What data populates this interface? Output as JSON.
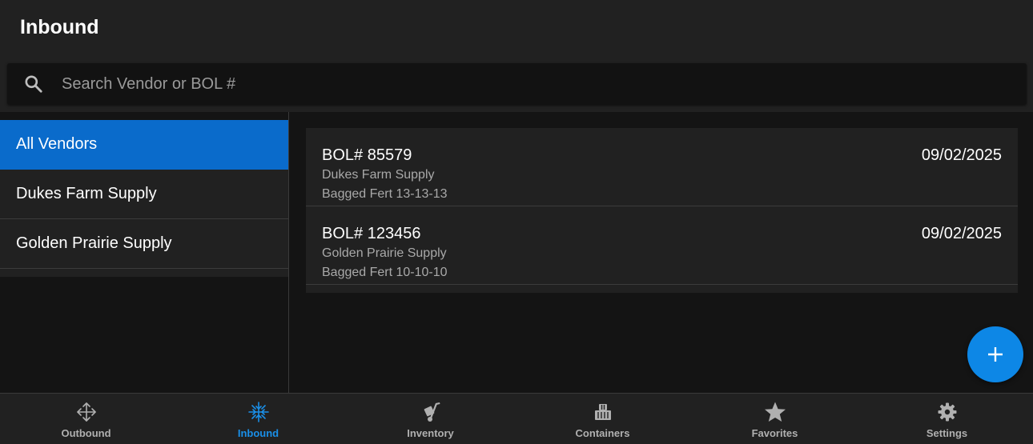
{
  "header": {
    "title": "Inbound"
  },
  "search": {
    "placeholder": "Search Vendor or BOL #",
    "value": ""
  },
  "sidebar": {
    "items": [
      {
        "label": "All Vendors",
        "active": true
      },
      {
        "label": "Dukes Farm Supply",
        "active": false
      },
      {
        "label": "Golden Prairie Supply",
        "active": false
      }
    ]
  },
  "shipments": [
    {
      "bol": "BOL# 85579",
      "date": "09/02/2025",
      "vendor": "Dukes Farm Supply",
      "product": "Bagged Fert 13-13-13"
    },
    {
      "bol": "BOL# 123456",
      "date": "09/02/2025",
      "vendor": "Golden Prairie Supply",
      "product": "Bagged Fert 10-10-10"
    }
  ],
  "fab": {
    "icon": "plus-icon"
  },
  "bottom_nav": {
    "items": [
      {
        "label": "Outbound",
        "icon": "move-arrows-icon",
        "active": false
      },
      {
        "label": "Inbound",
        "icon": "inbound-arrows-icon",
        "active": true
      },
      {
        "label": "Inventory",
        "icon": "hand-truck-icon",
        "active": false
      },
      {
        "label": "Containers",
        "icon": "containers-icon",
        "active": false
      },
      {
        "label": "Favorites",
        "icon": "star-icon",
        "active": false
      },
      {
        "label": "Settings",
        "icon": "gear-icon",
        "active": false
      }
    ]
  },
  "colors": {
    "accent": "#0a6bcb",
    "fab": "#0d87e6",
    "active_nav": "#1a8fe8",
    "surface": "#212121",
    "background": "#141414"
  }
}
